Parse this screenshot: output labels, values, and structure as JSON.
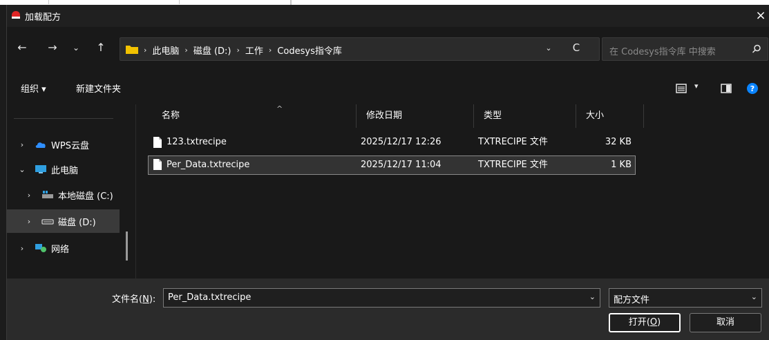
{
  "dialog": {
    "title": "加载配方",
    "close_label": "×"
  },
  "nav": {
    "back": "←",
    "forward": "→",
    "recent": "⌄",
    "up": "↑",
    "breadcrumbs": [
      "此电脑",
      "磁盘 (D:)",
      "工作",
      "Codesys指令库"
    ],
    "crumb_separator": "›",
    "address_dropdown": "⌄",
    "refresh": "C",
    "search_placeholder": "在 Codesys指令库 中搜索"
  },
  "toolbar": {
    "organize_label": "组织 ▾",
    "new_folder_label": "新建文件夹",
    "view_dropdown": "▾",
    "help": "?"
  },
  "sidebar": {
    "items": [
      {
        "label": "WPS云盘",
        "chevron": "›",
        "icon": "cloud-icon"
      },
      {
        "label": "此电脑",
        "chevron": "⌄",
        "icon": "computer-icon"
      },
      {
        "label": "本地磁盘 (C:)",
        "chevron": "›",
        "icon": "drive-c-icon"
      },
      {
        "label": "磁盘 (D:)",
        "chevron": "›",
        "icon": "drive-d-icon"
      },
      {
        "label": "网络",
        "chevron": "›",
        "icon": "network-icon"
      }
    ]
  },
  "file_list": {
    "columns": [
      "名称",
      "修改日期",
      "类型",
      "大小"
    ],
    "sort_indicator": "^",
    "rows": [
      {
        "name": "123.txtrecipe",
        "modified": "2025/12/17 12:26",
        "type": "TXTRECIPE 文件",
        "size": "32 KB"
      },
      {
        "name": "Per_Data.txtrecipe",
        "modified": "2025/12/17 11:04",
        "type": "TXTRECIPE 文件",
        "size": "1 KB"
      }
    ]
  },
  "footer": {
    "filename_label": "文件名",
    "filename_hotkey": "N",
    "filename_label_suffix": ":",
    "filename_value": "Per_Data.txtrecipe",
    "dropdown_glyph": "⌄",
    "filetype_value": "配方文件",
    "open_label": "打开",
    "open_hotkey": "O",
    "cancel_label": "取消"
  },
  "colors": {
    "background": "#191919",
    "panel": "#2b2b2b",
    "accent_blue": "#0a84ff",
    "folder_yellow": "#f2c200"
  }
}
